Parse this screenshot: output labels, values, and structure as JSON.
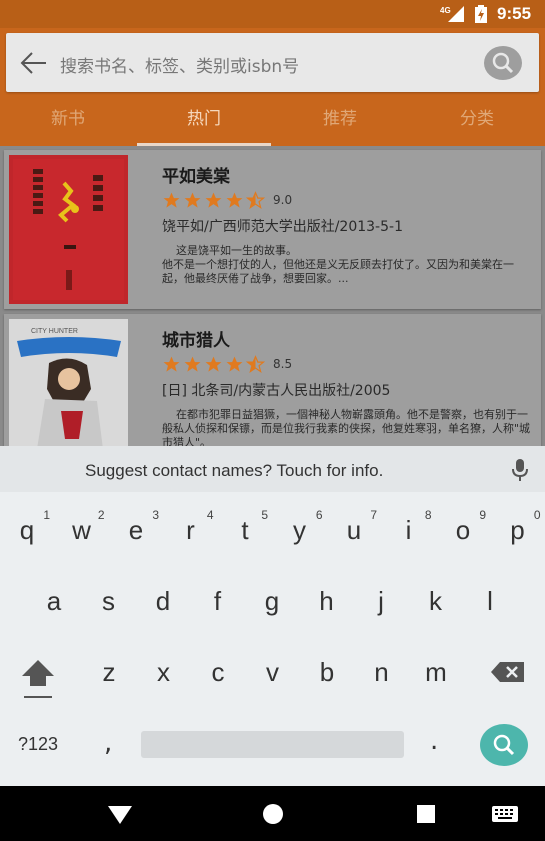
{
  "status_bar": {
    "network": "4G",
    "time": "9:55"
  },
  "search": {
    "placeholder": "搜索书名、标签、类别或isbn号"
  },
  "tabs": [
    {
      "label": "新书"
    },
    {
      "label": "热门"
    },
    {
      "label": "推荐"
    },
    {
      "label": "分类"
    }
  ],
  "active_tab": "热门",
  "books": [
    {
      "title": "平如美棠",
      "rating": "9.0",
      "stars": 4.5,
      "meta": "饶平如/广西师范大学出版社/2013-5-1",
      "description": "    这是饶平如一生的故事。\n他不是一个想打仗的人，但他还是义无反顾去打仗了。又因为和美棠在一起，他最终厌倦了战争，想要回家。..."
    },
    {
      "title": "城市猎人",
      "rating": "8.5",
      "stars": 4.5,
      "meta": "[日] 北条司/内蒙古人民出版社/2005",
      "description": "    在都市犯罪日益猖獗，一個神秘人物嶄露頭角。他不是警察，也有别于一般私人侦探和保镖，而是位我行我素的侠探，他复姓寒羽，单名獠，人称\"城市猎人\"。"
    }
  ],
  "keyboard": {
    "suggestion": "Suggest contact names? Touch for info.",
    "row1": [
      {
        "k": "q",
        "h": "1"
      },
      {
        "k": "w",
        "h": "2"
      },
      {
        "k": "e",
        "h": "3"
      },
      {
        "k": "r",
        "h": "4"
      },
      {
        "k": "t",
        "h": "5"
      },
      {
        "k": "y",
        "h": "6"
      },
      {
        "k": "u",
        "h": "7"
      },
      {
        "k": "i",
        "h": "8"
      },
      {
        "k": "o",
        "h": "9"
      },
      {
        "k": "p",
        "h": "0"
      }
    ],
    "row2": [
      "a",
      "s",
      "d",
      "f",
      "g",
      "h",
      "j",
      "k",
      "l"
    ],
    "row3": [
      "z",
      "x",
      "c",
      "v",
      "b",
      "n",
      "m"
    ],
    "symbols_key": "?123",
    "comma_key": ",",
    "period_key": "."
  },
  "colors": {
    "primary": "#c8661c",
    "status_bar": "#b85f17",
    "star": "#e07a1f",
    "action_key": "#4db6ac"
  }
}
